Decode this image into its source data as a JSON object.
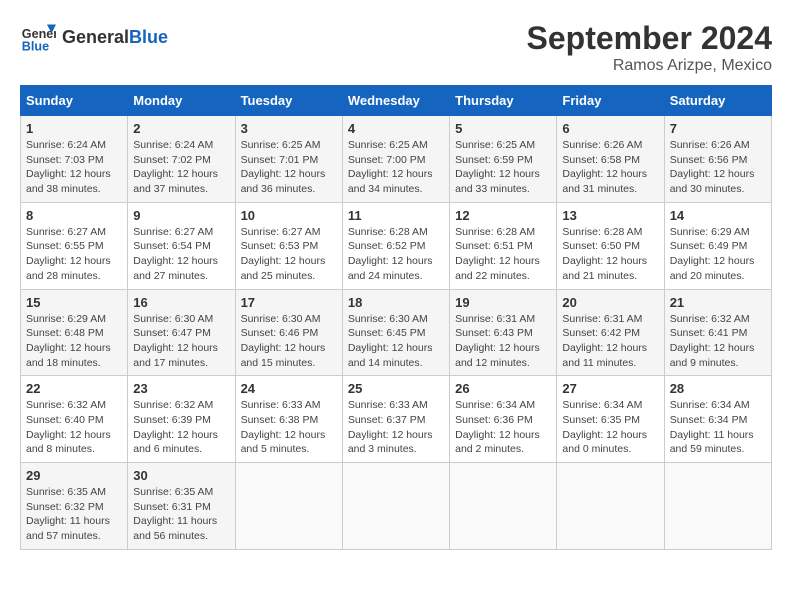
{
  "header": {
    "logo_line1": "General",
    "logo_line2": "Blue",
    "month": "September 2024",
    "location": "Ramos Arizpe, Mexico"
  },
  "weekdays": [
    "Sunday",
    "Monday",
    "Tuesday",
    "Wednesday",
    "Thursday",
    "Friday",
    "Saturday"
  ],
  "weeks": [
    [
      {
        "day": "1",
        "info": "Sunrise: 6:24 AM\nSunset: 7:03 PM\nDaylight: 12 hours and 38 minutes."
      },
      {
        "day": "2",
        "info": "Sunrise: 6:24 AM\nSunset: 7:02 PM\nDaylight: 12 hours and 37 minutes."
      },
      {
        "day": "3",
        "info": "Sunrise: 6:25 AM\nSunset: 7:01 PM\nDaylight: 12 hours and 36 minutes."
      },
      {
        "day": "4",
        "info": "Sunrise: 6:25 AM\nSunset: 7:00 PM\nDaylight: 12 hours and 34 minutes."
      },
      {
        "day": "5",
        "info": "Sunrise: 6:25 AM\nSunset: 6:59 PM\nDaylight: 12 hours and 33 minutes."
      },
      {
        "day": "6",
        "info": "Sunrise: 6:26 AM\nSunset: 6:58 PM\nDaylight: 12 hours and 31 minutes."
      },
      {
        "day": "7",
        "info": "Sunrise: 6:26 AM\nSunset: 6:56 PM\nDaylight: 12 hours and 30 minutes."
      }
    ],
    [
      {
        "day": "8",
        "info": "Sunrise: 6:27 AM\nSunset: 6:55 PM\nDaylight: 12 hours and 28 minutes."
      },
      {
        "day": "9",
        "info": "Sunrise: 6:27 AM\nSunset: 6:54 PM\nDaylight: 12 hours and 27 minutes."
      },
      {
        "day": "10",
        "info": "Sunrise: 6:27 AM\nSunset: 6:53 PM\nDaylight: 12 hours and 25 minutes."
      },
      {
        "day": "11",
        "info": "Sunrise: 6:28 AM\nSunset: 6:52 PM\nDaylight: 12 hours and 24 minutes."
      },
      {
        "day": "12",
        "info": "Sunrise: 6:28 AM\nSunset: 6:51 PM\nDaylight: 12 hours and 22 minutes."
      },
      {
        "day": "13",
        "info": "Sunrise: 6:28 AM\nSunset: 6:50 PM\nDaylight: 12 hours and 21 minutes."
      },
      {
        "day": "14",
        "info": "Sunrise: 6:29 AM\nSunset: 6:49 PM\nDaylight: 12 hours and 20 minutes."
      }
    ],
    [
      {
        "day": "15",
        "info": "Sunrise: 6:29 AM\nSunset: 6:48 PM\nDaylight: 12 hours and 18 minutes."
      },
      {
        "day": "16",
        "info": "Sunrise: 6:30 AM\nSunset: 6:47 PM\nDaylight: 12 hours and 17 minutes."
      },
      {
        "day": "17",
        "info": "Sunrise: 6:30 AM\nSunset: 6:46 PM\nDaylight: 12 hours and 15 minutes."
      },
      {
        "day": "18",
        "info": "Sunrise: 6:30 AM\nSunset: 6:45 PM\nDaylight: 12 hours and 14 minutes."
      },
      {
        "day": "19",
        "info": "Sunrise: 6:31 AM\nSunset: 6:43 PM\nDaylight: 12 hours and 12 minutes."
      },
      {
        "day": "20",
        "info": "Sunrise: 6:31 AM\nSunset: 6:42 PM\nDaylight: 12 hours and 11 minutes."
      },
      {
        "day": "21",
        "info": "Sunrise: 6:32 AM\nSunset: 6:41 PM\nDaylight: 12 hours and 9 minutes."
      }
    ],
    [
      {
        "day": "22",
        "info": "Sunrise: 6:32 AM\nSunset: 6:40 PM\nDaylight: 12 hours and 8 minutes."
      },
      {
        "day": "23",
        "info": "Sunrise: 6:32 AM\nSunset: 6:39 PM\nDaylight: 12 hours and 6 minutes."
      },
      {
        "day": "24",
        "info": "Sunrise: 6:33 AM\nSunset: 6:38 PM\nDaylight: 12 hours and 5 minutes."
      },
      {
        "day": "25",
        "info": "Sunrise: 6:33 AM\nSunset: 6:37 PM\nDaylight: 12 hours and 3 minutes."
      },
      {
        "day": "26",
        "info": "Sunrise: 6:34 AM\nSunset: 6:36 PM\nDaylight: 12 hours and 2 minutes."
      },
      {
        "day": "27",
        "info": "Sunrise: 6:34 AM\nSunset: 6:35 PM\nDaylight: 12 hours and 0 minutes."
      },
      {
        "day": "28",
        "info": "Sunrise: 6:34 AM\nSunset: 6:34 PM\nDaylight: 11 hours and 59 minutes."
      }
    ],
    [
      {
        "day": "29",
        "info": "Sunrise: 6:35 AM\nSunset: 6:32 PM\nDaylight: 11 hours and 57 minutes."
      },
      {
        "day": "30",
        "info": "Sunrise: 6:35 AM\nSunset: 6:31 PM\nDaylight: 11 hours and 56 minutes."
      },
      {
        "day": "",
        "info": ""
      },
      {
        "day": "",
        "info": ""
      },
      {
        "day": "",
        "info": ""
      },
      {
        "day": "",
        "info": ""
      },
      {
        "day": "",
        "info": ""
      }
    ]
  ]
}
